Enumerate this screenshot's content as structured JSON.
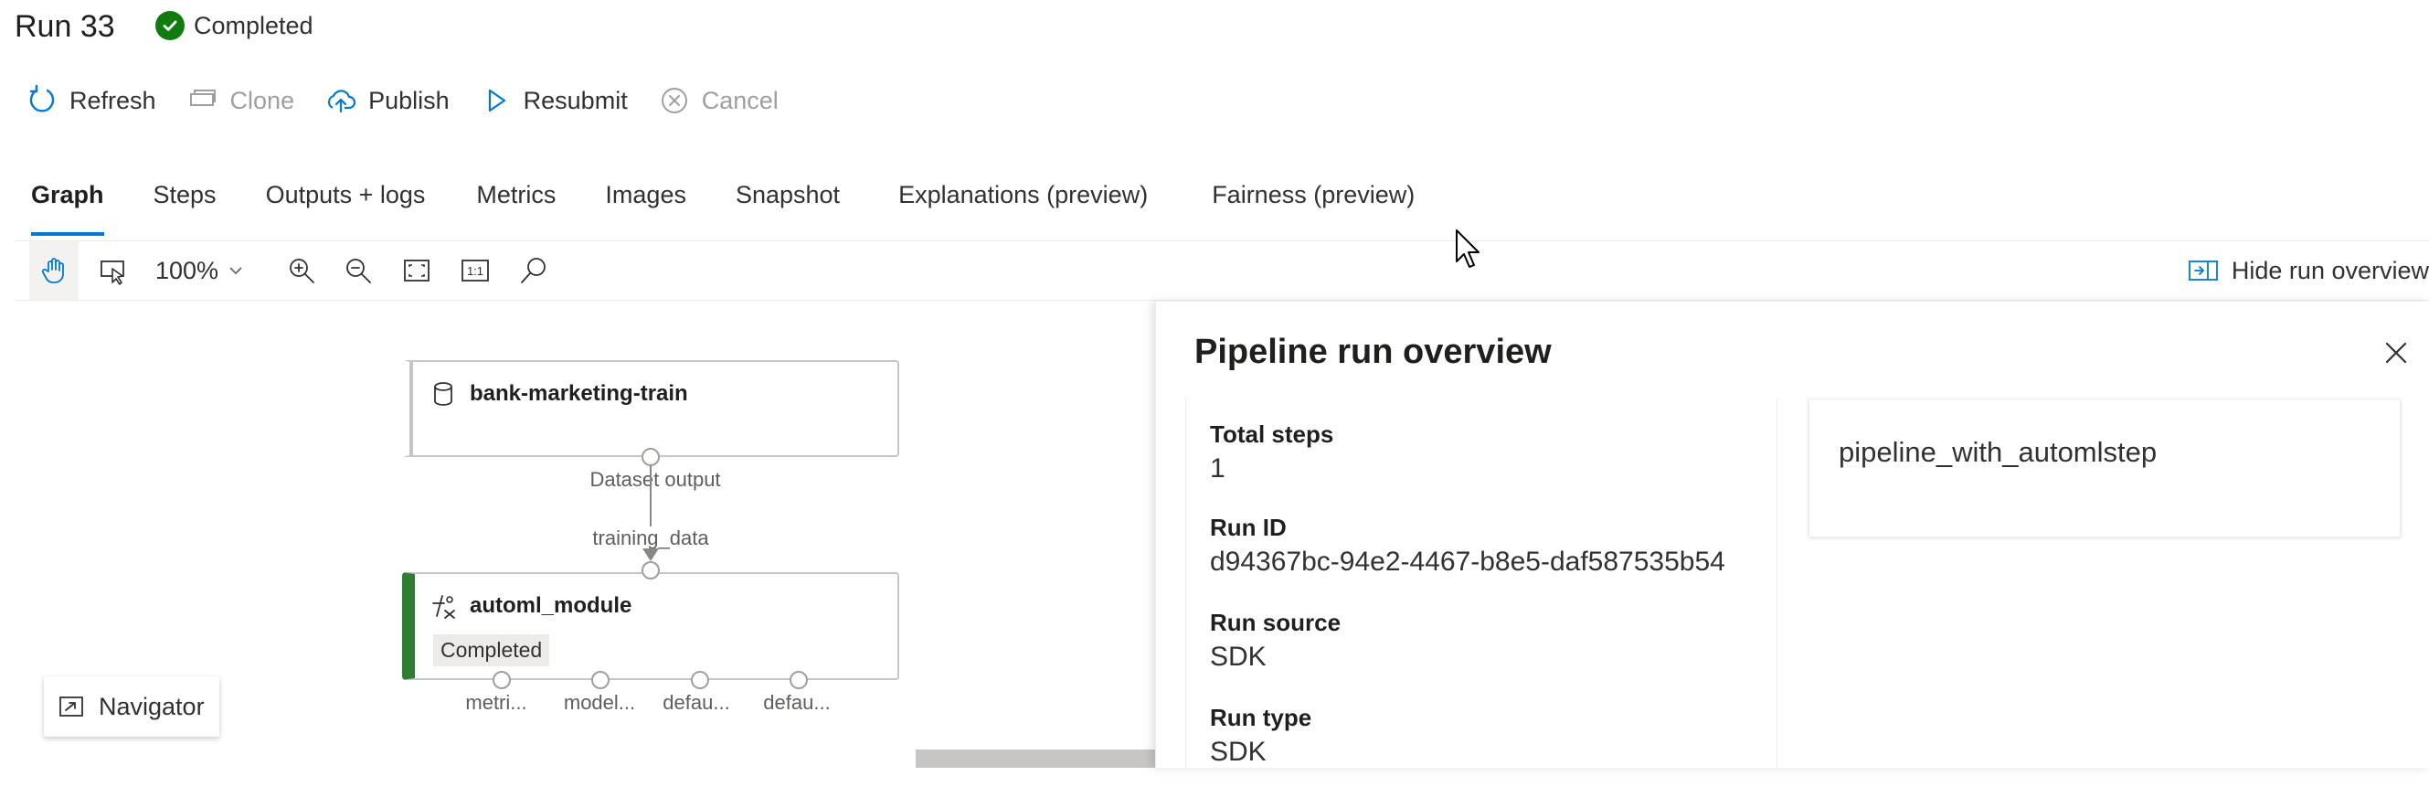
{
  "header": {
    "title": "Run 33",
    "status": "Completed",
    "status_color": "#107c10"
  },
  "commands": [
    {
      "label": "Refresh",
      "icon": "refresh-icon",
      "enabled": true
    },
    {
      "label": "Clone",
      "icon": "clone-icon",
      "enabled": false
    },
    {
      "label": "Publish",
      "icon": "cloud-upload-icon",
      "enabled": true
    },
    {
      "label": "Resubmit",
      "icon": "play-icon",
      "enabled": true
    },
    {
      "label": "Cancel",
      "icon": "cancel-icon",
      "enabled": false
    }
  ],
  "tabs": [
    {
      "label": "Graph",
      "active": true
    },
    {
      "label": "Steps"
    },
    {
      "label": "Outputs + logs"
    },
    {
      "label": "Metrics"
    },
    {
      "label": "Images"
    },
    {
      "label": "Snapshot"
    },
    {
      "label": "Explanations (preview)"
    },
    {
      "label": "Fairness (preview)"
    }
  ],
  "toolbar": {
    "zoom": "100%",
    "icons": [
      "pan-hand-icon",
      "select-icon",
      "zoom-in-icon",
      "zoom-out-icon",
      "fit-screen-icon",
      "actual-size-icon",
      "search-icon"
    ],
    "actual_size_label": "1:1",
    "hide_overview_label": "Hide run overview"
  },
  "graph": {
    "dataset_node": {
      "title": "bank-marketing-train",
      "icon": "database-icon",
      "output_label": "Dataset output"
    },
    "edge_label": "training_data",
    "module_node": {
      "title": "automl_module",
      "icon": "automl-icon",
      "status": "Completed",
      "accent": "#2e7d32",
      "outputs": [
        "metri...",
        "model...",
        "defau...",
        "defau..."
      ]
    },
    "navigator_label": "Navigator"
  },
  "overview": {
    "title": "Pipeline run overview",
    "props": [
      {
        "label": "Total steps",
        "value": "1"
      },
      {
        "label": "Run ID",
        "value": "d94367bc-94e2-4467-b8e5-daf587535b54"
      },
      {
        "label": "Run source",
        "value": "SDK"
      },
      {
        "label": "Run type",
        "value": "SDK"
      }
    ],
    "pipeline_name": "pipeline_with_automlstep"
  },
  "accent": "#0078d4"
}
